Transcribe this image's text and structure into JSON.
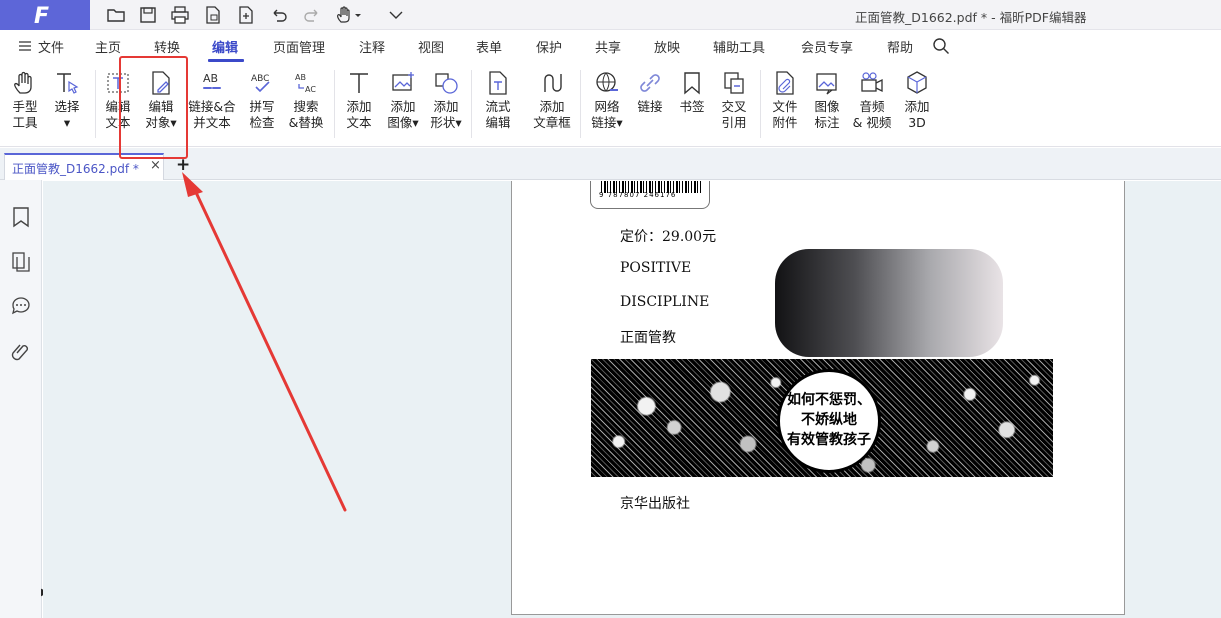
{
  "window": {
    "title": "正面管教_D1662.pdf * - 福昕PDF编辑器"
  },
  "menu": {
    "file": "文件",
    "items": [
      "主页",
      "转换",
      "编辑",
      "页面管理",
      "注释",
      "视图",
      "表单",
      "保护",
      "共享",
      "放映",
      "辅助工具",
      "会员专享",
      "帮助"
    ],
    "active": "编辑"
  },
  "toolbar": {
    "tools": [
      {
        "label": "手型\n工具",
        "icon": "hand-icon"
      },
      {
        "label": "选择\n▾",
        "icon": "select-text-icon"
      },
      {
        "label": "编辑\n文本",
        "icon": "edit-text-icon"
      },
      {
        "label": "编辑\n对象▾",
        "icon": "edit-object-icon"
      },
      {
        "label": "链接&合\n并文本",
        "icon": "link-merge-text-icon"
      },
      {
        "label": "拼写\n检查",
        "icon": "spell-check-icon"
      },
      {
        "label": "搜索\n&替换",
        "icon": "search-replace-icon"
      },
      {
        "label": "添加\n文本",
        "icon": "add-text-icon"
      },
      {
        "label": "添加\n图像▾",
        "icon": "add-image-icon"
      },
      {
        "label": "添加\n形状▾",
        "icon": "add-shape-icon"
      },
      {
        "label": "流式\n编辑",
        "icon": "flow-edit-icon"
      },
      {
        "label": "添加\n文章框",
        "icon": "add-article-box-icon"
      },
      {
        "label": "网络\n链接▾",
        "icon": "web-link-icon"
      },
      {
        "label": "链接",
        "icon": "link-icon"
      },
      {
        "label": "书签",
        "icon": "bookmark-icon"
      },
      {
        "label": "交叉\n引用",
        "icon": "cross-reference-icon"
      },
      {
        "label": "文件\n附件",
        "icon": "file-attachment-icon"
      },
      {
        "label": "图像\n标注",
        "icon": "image-annotation-icon"
      },
      {
        "label": "音频\n& 视频",
        "icon": "audio-video-icon"
      },
      {
        "label": "添加\n3D",
        "icon": "add-3d-icon"
      }
    ]
  },
  "tabs": {
    "doc_name": "正面管教_D1662.pdf *",
    "close": "×",
    "add": "+"
  },
  "document": {
    "barcode_digits": "9 787807 246176",
    "price": "定价：29.00元",
    "line1": "POSITIVE",
    "line2": "DISCIPLINE",
    "line3": "正面管教",
    "banner_text": [
      "如何不惩罚、",
      "不娇纵地",
      "有效管教孩子"
    ],
    "publisher": "京华出版社"
  },
  "colors": {
    "accent": "#3b49c9",
    "logo_bg": "#5d66d8",
    "annotation": "#e53935"
  }
}
